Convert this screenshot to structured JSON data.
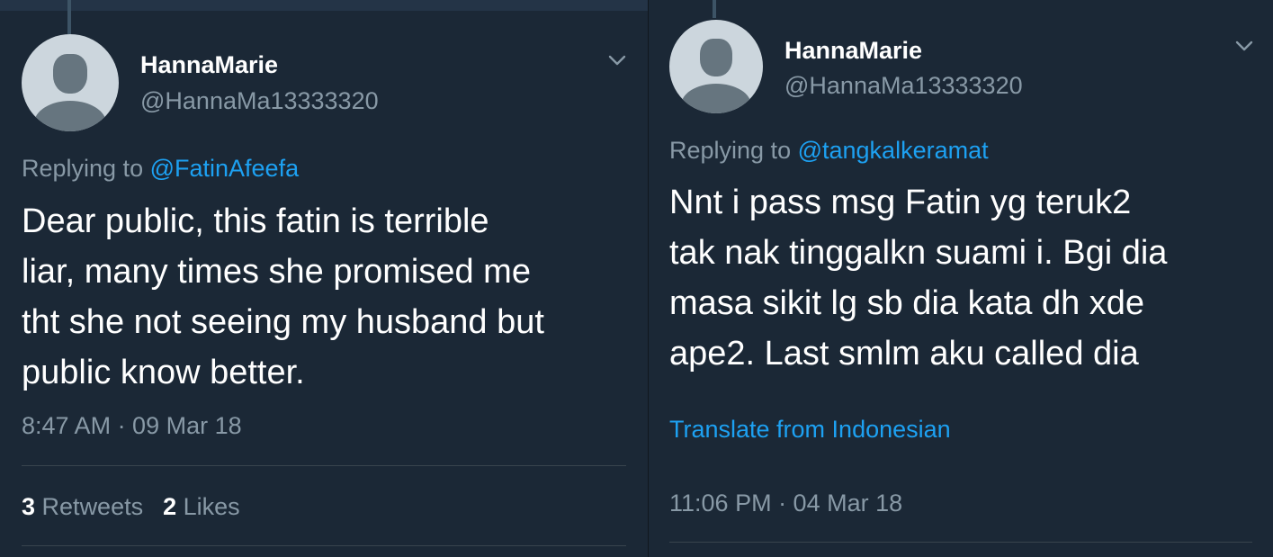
{
  "colors": {
    "background": "#1b2836",
    "text_primary": "#ffffff",
    "text_secondary": "#8899a6",
    "link": "#1da1f2",
    "divider": "#38444d"
  },
  "tweets": [
    {
      "display_name": "HannaMarie",
      "handle": "@HannaMa13333320",
      "replying_prefix": "Replying to ",
      "replying_to": "@FatinAfeefa",
      "text_lines": [
        "Dear public, this fatin is terrible",
        "liar, many times she promised me",
        "tht she not seeing my husband but",
        "public know better."
      ],
      "timestamp": "8:47 AM · 09 Mar 18",
      "retweets_count": "3",
      "retweets_label": "Retweets",
      "likes_count": "2",
      "likes_label": "Likes",
      "avatar_icon": "default-avatar-icon",
      "menu_icon": "chevron-down-icon"
    },
    {
      "display_name": "HannaMarie",
      "handle": "@HannaMa13333320",
      "replying_prefix": "Replying to ",
      "replying_to": "@tangkalkeramat",
      "text_lines": [
        "Nnt i pass msg Fatin yg teruk2",
        "tak nak tinggalkn suami i. Bgi dia",
        "masa sikit lg sb dia kata dh xde",
        "ape2. Last smlm aku called dia"
      ],
      "translate_label": "Translate from Indonesian",
      "timestamp": "11:06 PM · 04 Mar 18",
      "avatar_icon": "default-avatar-icon",
      "menu_icon": "chevron-down-icon"
    }
  ]
}
